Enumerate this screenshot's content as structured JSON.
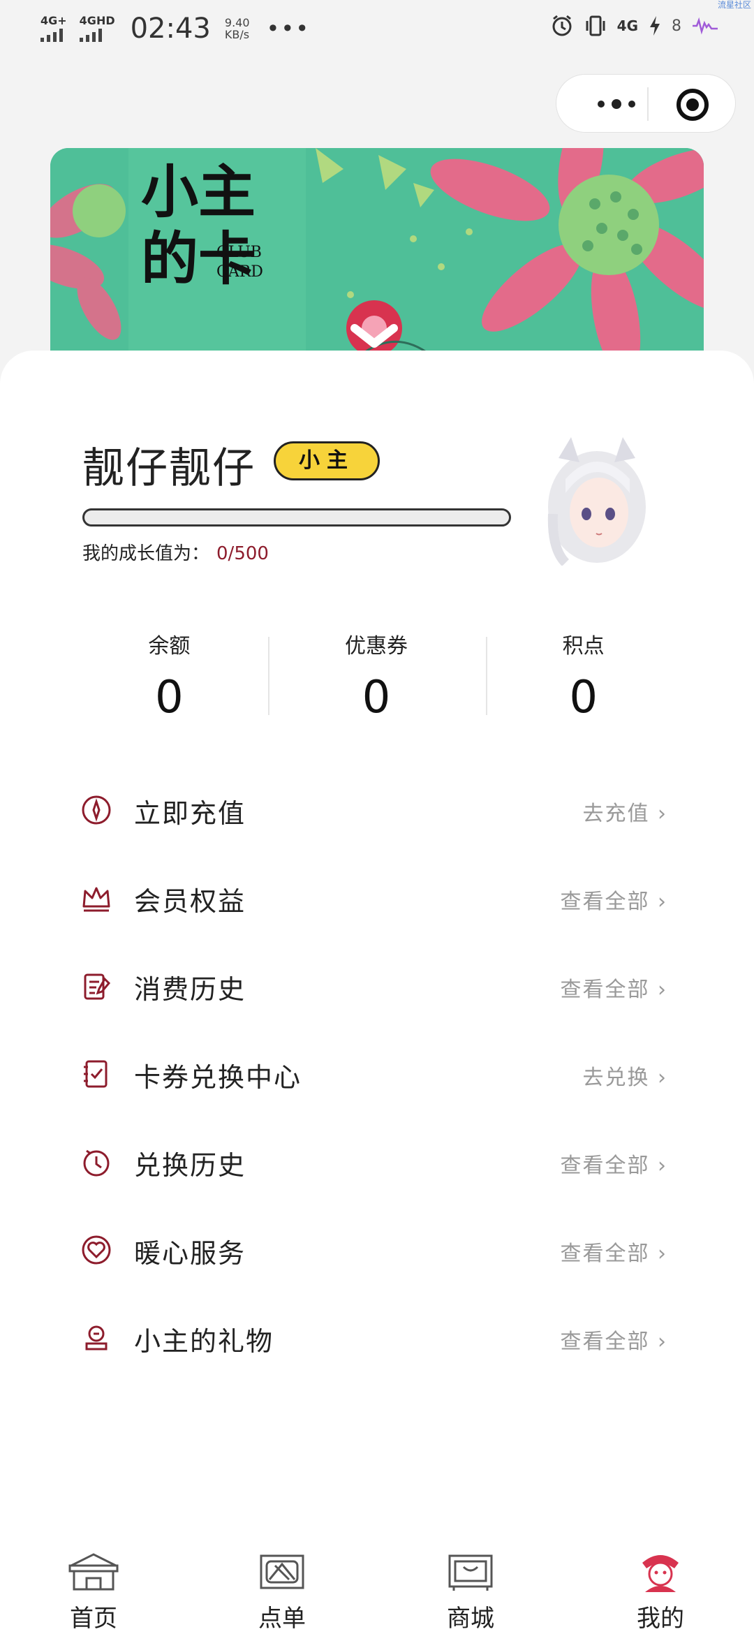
{
  "status_bar": {
    "signal1": "4G+",
    "signal2": "4GHD",
    "time": "02:43",
    "speed_value": "9.40",
    "speed_unit": "KB/s",
    "more": "•••",
    "right_net": "4G",
    "battery": "8",
    "corner_text": "流星社区"
  },
  "banner": {
    "title_line1": "小主",
    "title_line2": "的卡",
    "sub_line1": "CLUB",
    "sub_line2": "CARD",
    "colors": {
      "bg": "#4fbf98",
      "petal": "#e36b8a"
    }
  },
  "profile": {
    "name": "靓仔靓仔",
    "level_badge": "小主",
    "growth_label": "我的成长值为：",
    "growth_value": "0/500",
    "growth_fraction": 0
  },
  "stats": [
    {
      "label": "余额",
      "value": "0"
    },
    {
      "label": "优惠券",
      "value": "0"
    },
    {
      "label": "积点",
      "value": "0"
    }
  ],
  "menu": [
    {
      "title": "立即充值",
      "action": "去充值",
      "icon": "compass-icon"
    },
    {
      "title": "会员权益",
      "action": "查看全部",
      "icon": "crown-icon"
    },
    {
      "title": "消费历史",
      "action": "查看全部",
      "icon": "receipt-icon"
    },
    {
      "title": "卡券兑换中心",
      "action": "去兑换",
      "icon": "checklist-icon"
    },
    {
      "title": "兑换历史",
      "action": "查看全部",
      "icon": "clock-icon"
    },
    {
      "title": "暖心服务",
      "action": "查看全部",
      "icon": "heart-icon"
    },
    {
      "title": "小主的礼物",
      "action": "查看全部",
      "icon": "gift-icon"
    }
  ],
  "tabs": [
    {
      "label": "首页",
      "icon": "shop-icon"
    },
    {
      "label": "点单",
      "icon": "order-icon"
    },
    {
      "label": "商城",
      "icon": "mall-icon"
    },
    {
      "label": "我的",
      "icon": "profile-icon"
    }
  ],
  "colors": {
    "accent": "#8d1c2c",
    "badge": "#f7d33a"
  }
}
